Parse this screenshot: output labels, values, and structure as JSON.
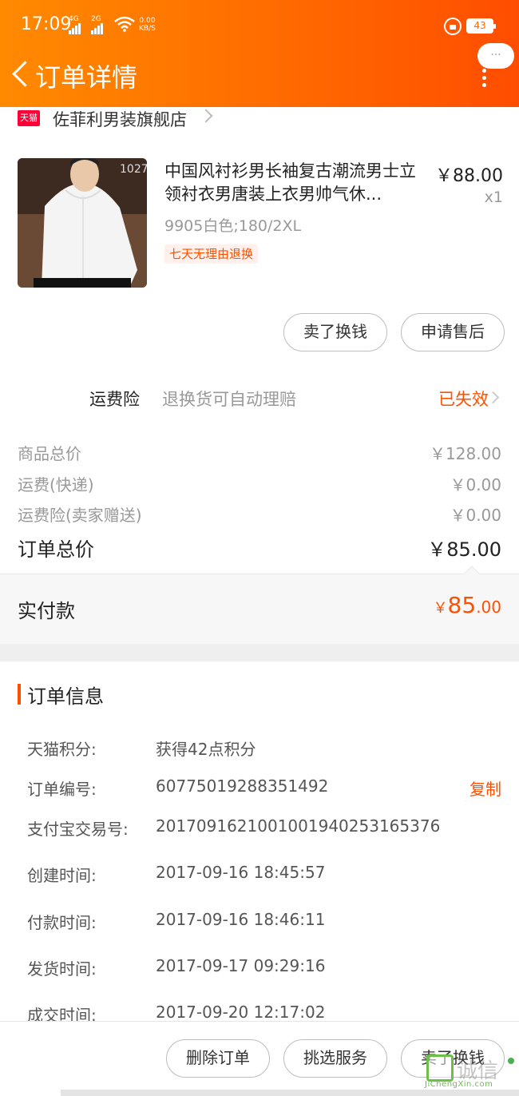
{
  "status_bar": {
    "time": "17:09",
    "net1": "4G",
    "net2": "2G",
    "speed_value": "0.00",
    "speed_unit": "KB/S",
    "battery": "43"
  },
  "header": {
    "title": "订单详情",
    "more_label": "···"
  },
  "shop": {
    "badge": "天猫",
    "name": "佐菲利男装旗舰店"
  },
  "product": {
    "title": "中国风衬衫男长袖复古潮流男士立领衬衣男唐装上衣男帅气休...",
    "sku": "9905白色;180/2XL",
    "tag": "七天无理由退换",
    "price": "￥88.00",
    "quantity": "x1",
    "buttons": {
      "sell": "卖了换钱",
      "after_sale": "申请售后"
    }
  },
  "insurance": {
    "label": "运费险",
    "description": "退换货可自动理赔",
    "status": "已失效"
  },
  "price_breakdown": {
    "rows": [
      {
        "label": "商品总价",
        "value": "￥128.00"
      },
      {
        "label": "运费(快递)",
        "value": "￥0.00"
      },
      {
        "label": "运费险(卖家赠送)",
        "value": "￥0.00"
      }
    ],
    "total_label": "订单总价",
    "total_value": "￥85.00",
    "paid_label": "实付款",
    "paid_currency": "￥",
    "paid_integer": "85",
    "paid_decimal": ".00"
  },
  "order_info": {
    "title": "订单信息",
    "rows": [
      {
        "label": "天猫积分:",
        "value": "获得42点积分"
      },
      {
        "label": "订单编号:",
        "value": "60775019288351492"
      },
      {
        "label": "支付宝交易号:",
        "value": "2017091621001001940253165376"
      },
      {
        "label": "创建时间:",
        "value": "2017-09-16 18:45:57"
      },
      {
        "label": "付款时间:",
        "value": "2017-09-16 18:46:11"
      },
      {
        "label": "发货时间:",
        "value": "2017-09-17 09:29:16"
      },
      {
        "label": "成交时间:",
        "value": "2017-09-20 12:17:02"
      }
    ],
    "copy_label": "复制"
  },
  "bottom_bar": {
    "buttons": [
      "删除订单",
      "挑选服务",
      "卖了换钱"
    ]
  },
  "watermark": {
    "text": "诚信",
    "sub": "JiChengXin.com"
  },
  "colors": {
    "accent": "#ff5000",
    "header_start": "#ff8a00",
    "header_end": "#ff4d00",
    "tmall_red": "#ff0036"
  }
}
